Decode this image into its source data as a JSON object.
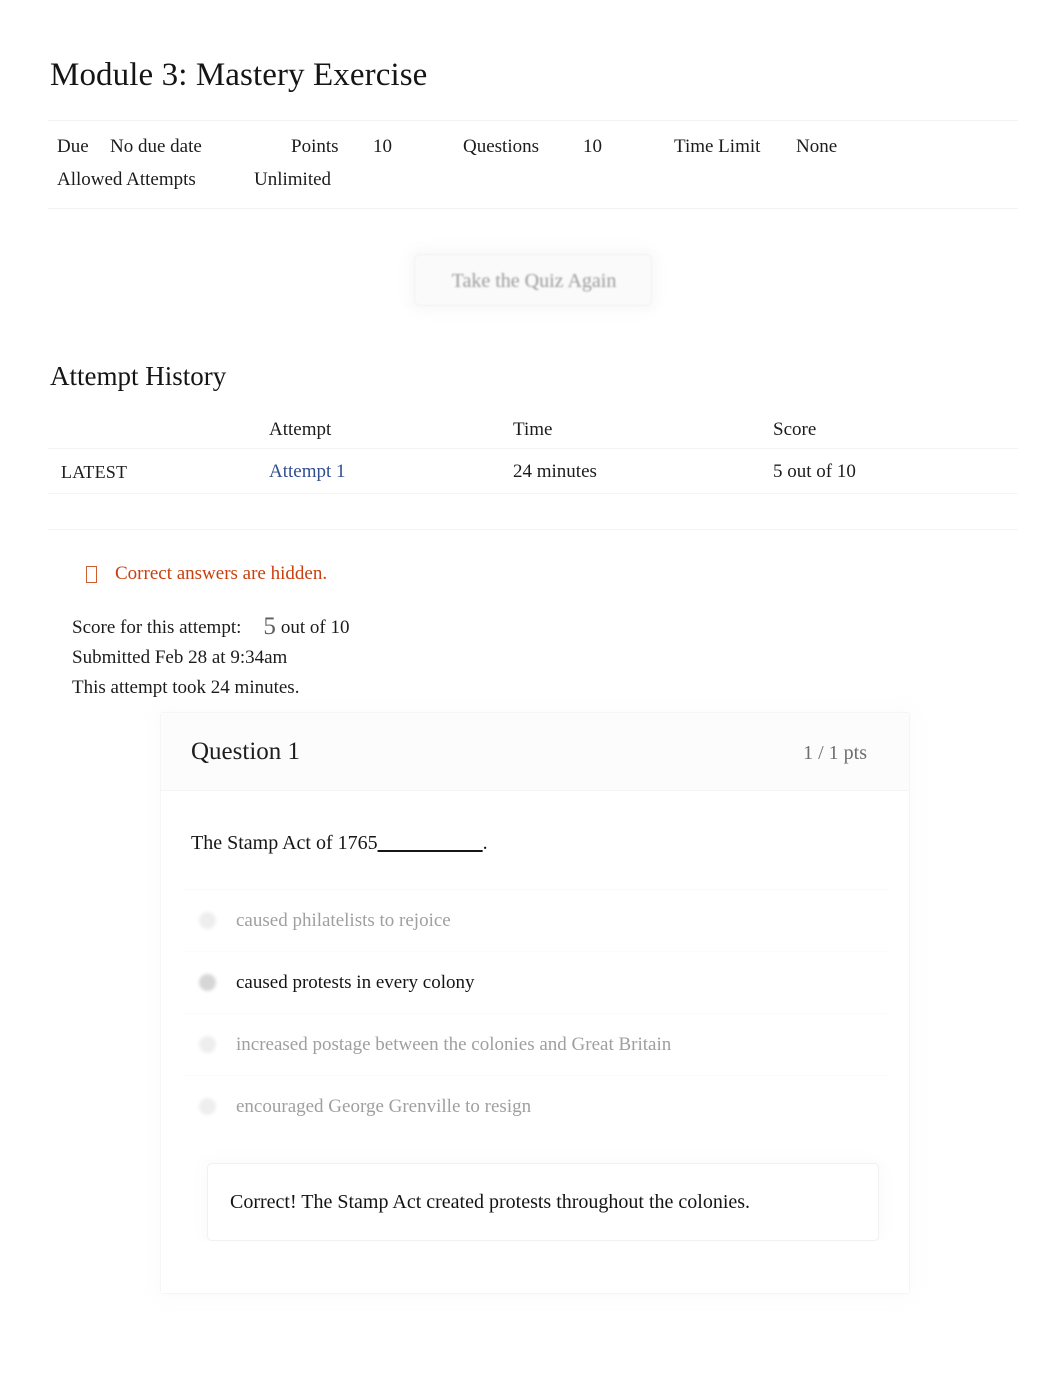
{
  "quiz": {
    "title": "Module 3: Mastery Exercise",
    "meta": {
      "due_label": "Due",
      "due_value": "No due date",
      "points_label": "Points",
      "points_value": "10",
      "questions_label": "Questions",
      "questions_value": "10",
      "time_limit_label": "Time Limit",
      "time_limit_value": "None",
      "allowed_attempts_label": "Allowed Attempts",
      "allowed_attempts_value": "Unlimited"
    },
    "retake_button_label": "Take the Quiz Again"
  },
  "attempt_history": {
    "heading": "Attempt History",
    "columns": {
      "kept": "",
      "attempt": "Attempt",
      "time": "Time",
      "score": "Score"
    },
    "rows": [
      {
        "kept": "LATEST",
        "attempt": "Attempt 1",
        "time": "24 minutes",
        "score": "5 out of 10"
      }
    ]
  },
  "notice": {
    "icon": "warning-box-icon",
    "text": "Correct answers are hidden.",
    "color": "#c8400f"
  },
  "attempt_summary": {
    "score_label": "Score for this attempt:",
    "score_value": "5",
    "score_suffix": "out of 10",
    "submitted": "Submitted Feb 28 at 9:34am",
    "duration": "This attempt took 24 minutes."
  },
  "questions": [
    {
      "name": "Question 1",
      "points": "1 / 1 pts",
      "text_prefix": "The Stamp Act of 1765",
      "text_blank": "__________",
      "text_suffix": ".",
      "answers": [
        {
          "label": "caused philatelists to rejoice",
          "selected": false
        },
        {
          "label": "caused protests in every colony",
          "selected": true
        },
        {
          "label": "increased postage between the colonies and Great Britain",
          "selected": false
        },
        {
          "label": "encouraged George Grenville to resign",
          "selected": false
        }
      ],
      "feedback": "Correct! The Stamp Act created protests throughout the colonies."
    }
  ]
}
